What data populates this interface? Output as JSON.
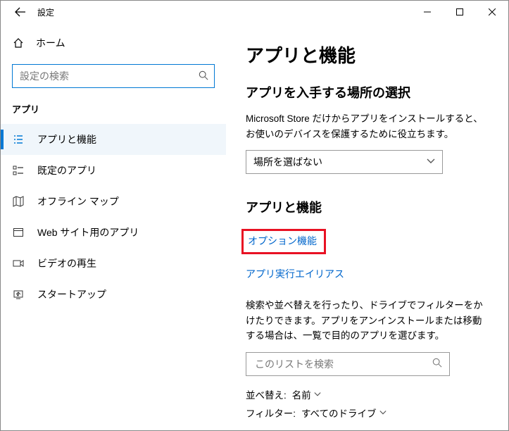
{
  "window": {
    "title": "設定"
  },
  "sidebar": {
    "home": "ホーム",
    "search_placeholder": "設定の検索",
    "section": "アプリ",
    "items": [
      {
        "label": "アプリと機能"
      },
      {
        "label": "既定のアプリ"
      },
      {
        "label": "オフライン マップ"
      },
      {
        "label": "Web サイト用のアプリ"
      },
      {
        "label": "ビデオの再生"
      },
      {
        "label": "スタートアップ"
      }
    ]
  },
  "main": {
    "h1": "アプリと機能",
    "source": {
      "heading": "アプリを入手する場所の選択",
      "desc": "Microsoft Store だけからアプリをインストールすると、お使いのデバイスを保護するために役立ちます。",
      "dropdown_value": "場所を選ばない"
    },
    "apps": {
      "heading": "アプリと機能",
      "link_optional": "オプション機能",
      "link_alias": "アプリ実行エイリアス",
      "desc": "検索や並べ替えを行ったり、ドライブでフィルターをかけたりできます。アプリをアンインストールまたは移動する場合は、一覧で目的のアプリを選びます。",
      "list_search_placeholder": "このリストを検索",
      "sort_label": "並べ替え:",
      "sort_value": "名前",
      "filter_label": "フィルター:",
      "filter_value": "すべてのドライブ"
    }
  }
}
